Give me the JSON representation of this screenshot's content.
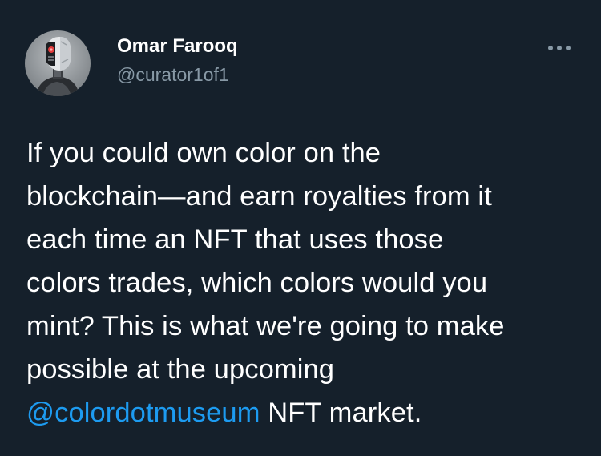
{
  "tweet": {
    "author": {
      "display_name": "Omar Farooq",
      "handle": "@curator1of1"
    },
    "more_label": "...",
    "text_lines": [
      "If you could own color on the",
      "blockchain—and earn royalties from it",
      "each time an NFT that uses those",
      "colors trades, which colors would you",
      "mint? This is what we're going to make",
      "possible at the upcoming"
    ],
    "last_line": {
      "mention": "@colordotmuseum",
      "rest": " NFT market."
    }
  },
  "colors": {
    "background": "#15202b",
    "text": "#ffffff",
    "secondary": "#8899a6",
    "link": "#1d9bf0"
  },
  "icons": {
    "avatar": "robot-head-avatar-icon",
    "more": "more-dots-icon"
  }
}
